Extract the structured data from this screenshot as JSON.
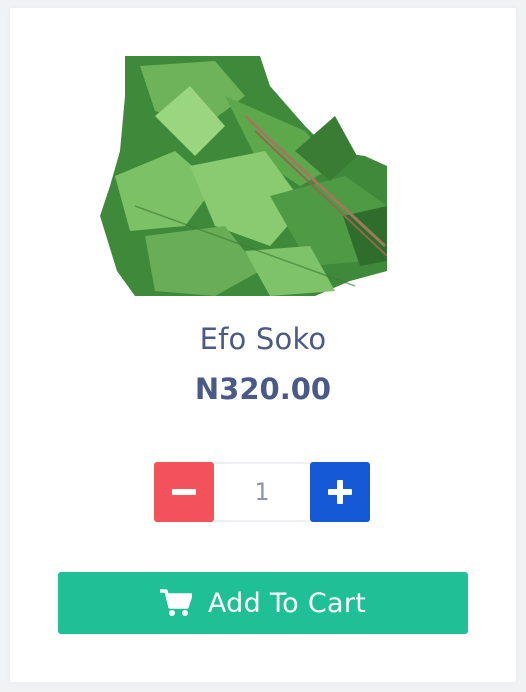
{
  "product": {
    "name": "Efo Soko",
    "price": "N320.00",
    "image_icon": "leafy-greens-image"
  },
  "quantity": {
    "value": "1",
    "decrement_icon": "minus-icon",
    "increment_icon": "plus-icon"
  },
  "cart": {
    "button_label": "Add To Cart",
    "icon": "shopping-cart-icon"
  },
  "colors": {
    "text": "#4a5a86",
    "decrement": "#f3525b",
    "increment": "#1559d6",
    "add_to_cart": "#20c097"
  }
}
